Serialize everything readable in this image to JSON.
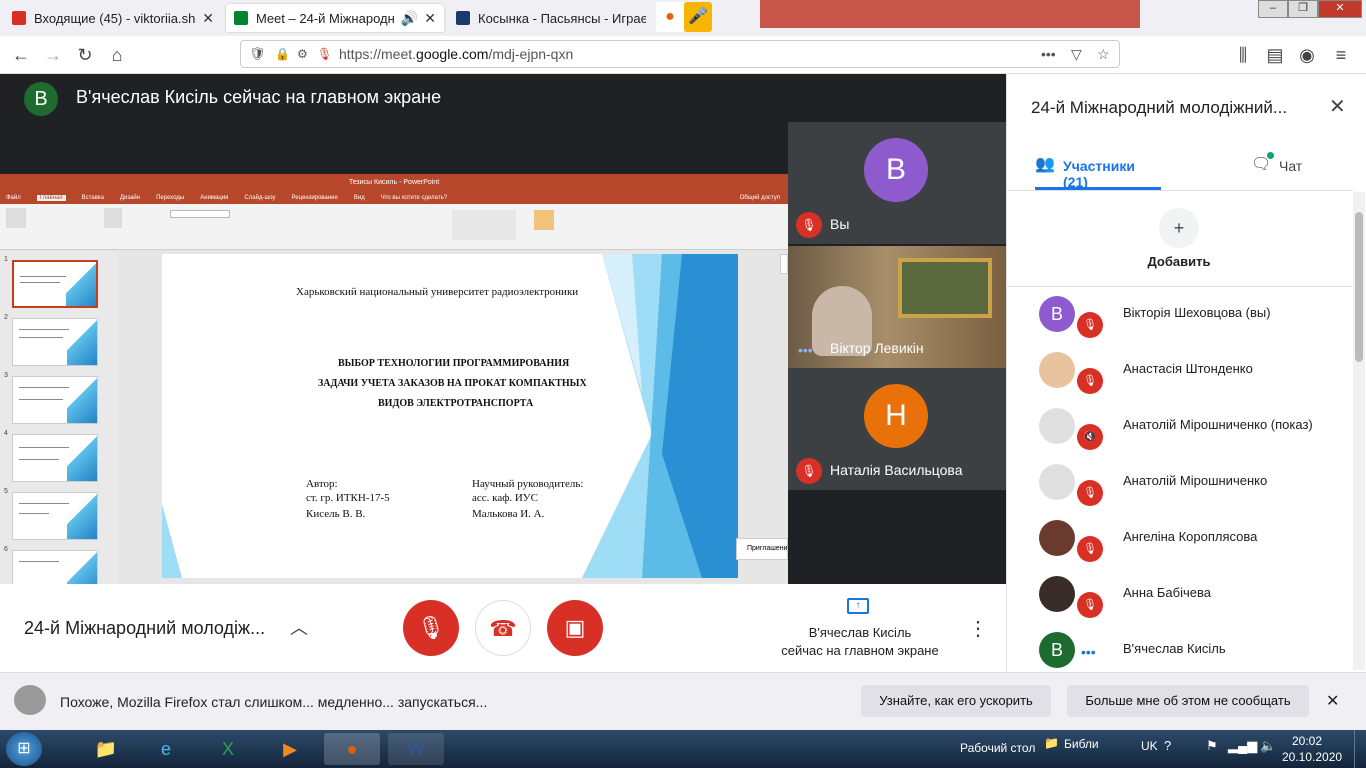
{
  "browser": {
    "tabs": [
      {
        "title": "Входящие (45) - viktoriia.shekh",
        "icon": "gmail-icon",
        "color": "#d93025"
      },
      {
        "title": "Meet – 24-й Міжнародний",
        "icon": "meet-icon",
        "color": "#00832d"
      },
      {
        "title": "Косынка - Пасьянсы - Играем",
        "icon": "cards-icon",
        "color": "#1a3a6b"
      }
    ],
    "url_prefix": "https://meet.",
    "url_domain": "google.com",
    "url_path": "/mdj-ejpn-qxn"
  },
  "meet": {
    "presenter_initial": "В",
    "presenter_banner": "В'ячеслав Кисіль сейчас на главном экране",
    "tiles": [
      {
        "initial": "В",
        "name": "Вы",
        "color": "#8e5bcf"
      },
      {
        "name": "Віктор Левикін"
      },
      {
        "initial": "Н",
        "name": "Наталія Васильцова",
        "color": "#e8710a"
      }
    ],
    "meeting_title": "24-й Міжнародний молодіж...",
    "presenting_line1": "В'ячеслав Кисіль",
    "presenting_line2": "сейчас на главном экране"
  },
  "ppt": {
    "window_title": "Тезисы Кисиль - PowerPoint",
    "menu": [
      "Файл",
      "Главная",
      "Вставка",
      "Дизайн",
      "Переходы",
      "Анимация",
      "Слайд-шоу",
      "Рецензирование",
      "Вид",
      "Что вы хотите сделать?"
    ],
    "share": "Общий доступ",
    "thumb_numbers": [
      "1",
      "2",
      "3",
      "4",
      "5",
      "6"
    ],
    "side_tag": "Приглашени",
    "slide": {
      "university": "Харьковский национальный университет радиоэлектроники",
      "title_line1": "ВЫБОР ТЕХНОЛОГИИ ПРОГРАММИРОВАНИЯ",
      "title_line2": "ЗАДАЧИ УЧЕТА ЗАКАЗОВ НА ПРОКАТ КОМПАКТНЫХ",
      "title_line3": "ВИДОВ ЭЛЕКТРОТРАНСПОРТА",
      "author_label": "Автор:",
      "author_group": "ст. гр. ИТКН-17-5",
      "author_name": "Кисель В. В.",
      "advisor_label": "Научный руководитель:",
      "advisor_pos": "асс. каф. ИУС",
      "advisor_name": "Малькова И. А."
    }
  },
  "panel": {
    "title": "24-й Міжнародний молодіжний...",
    "tab_participants": "Участники (21)",
    "tab_chat": "Чат",
    "add_label": "Добавить",
    "participants": [
      {
        "name": "Вікторія Шеховцова (вы)",
        "initial": "В",
        "color": "#8e5bcf",
        "muted": true
      },
      {
        "name": "Анастасія Штонденко",
        "color": "#e8c39e",
        "muted": true
      },
      {
        "name": "Анатолій Мірошниченко (показ)",
        "color": "#e0e0e0",
        "muted": true
      },
      {
        "name": "Анатолій Мірошниченко",
        "color": "#e0e0e0",
        "muted": true
      },
      {
        "name": "Ангеліна Короплясова",
        "color": "#6b3a2e",
        "muted": true
      },
      {
        "name": "Анна Бабічева",
        "color": "#3a2c28",
        "muted": true
      },
      {
        "name": "В'ячеслав Кисіль",
        "initial": "В",
        "color": "#1e6b2f",
        "muted": false
      }
    ]
  },
  "notification": {
    "text": "Похоже, Mozilla Firefox стал слишком... медленно... запускаться...",
    "btn_learn": "Узнайте, как его ускорить",
    "btn_dismiss": "Больше мне об этом не сообщать"
  },
  "taskbar": {
    "desktop": "Рабочий стол",
    "library": "Библи",
    "lang": "UK",
    "time": "20:02",
    "date": "20.10.2020"
  }
}
